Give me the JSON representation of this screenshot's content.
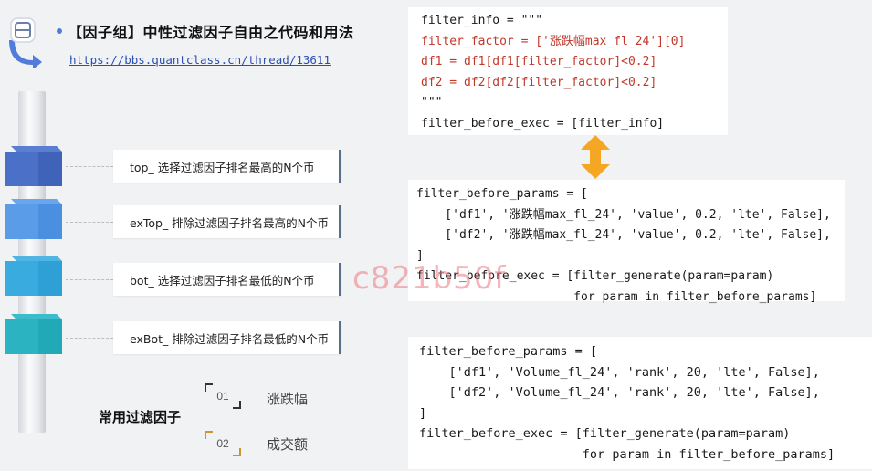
{
  "header": {
    "title": "【因子组】中性过滤因子自由之代码和用法",
    "link": "https://bbs.quantclass.cn/thread/13611"
  },
  "options": [
    {
      "label": "top_ 选择过滤因子排名最高的N个币",
      "color": "#3f63b8"
    },
    {
      "label": "exTop_ 排除过滤因子排名最高的N个币",
      "color": "#4a8fe0"
    },
    {
      "label": "bot_ 选择过滤因子排名最低的N个币",
      "color": "#2ea0d6"
    },
    {
      "label": "exBot_ 排除过滤因子排名最低的N个币",
      "color": "#21a9b8"
    }
  ],
  "common_filters": {
    "title": "常用过滤因子",
    "items": [
      {
        "num": "01",
        "label": "涨跌幅"
      },
      {
        "num": "02",
        "label": "成交额"
      }
    ]
  },
  "code_blocks": {
    "block1": {
      "l1": "filter_info = \"\"\"",
      "l2": "filter_factor = ['涨跌幅max_fl_24'][0]",
      "l3": "df1 = df1[df1[filter_factor]<0.2]",
      "l4": "df2 = df2[df2[filter_factor]<0.2]",
      "l5": "\"\"\"",
      "l6": "filter_before_exec = [filter_info]"
    },
    "block2": {
      "l1": "filter_before_params = [",
      "l2": "    ['df1', '涨跌幅max_fl_24', 'value', 0.2, 'lte', False],",
      "l3": "    ['df2', '涨跌幅max_fl_24', 'value', 0.2, 'lte', False],",
      "l4": "]",
      "l5": "filter_before_exec = [filter_generate(param=param)",
      "l6": "                      for param in filter_before_params]"
    },
    "block3": {
      "l1": "filter_before_params = [",
      "l2": "    ['df1', 'Volume_fl_24', 'rank', 20, 'lte', False],",
      "l3": "    ['df2', 'Volume_fl_24', 'rank', 20, 'lte', False],",
      "l4": "]",
      "l5": "filter_before_exec = [filter_generate(param=param)",
      "l6": "                      for param in filter_before_params]"
    }
  },
  "watermark": "c821b50f",
  "colors": {
    "arrow": "#f5a623",
    "accent": "#2a4fb0",
    "code_highlight": "#c0392b"
  }
}
